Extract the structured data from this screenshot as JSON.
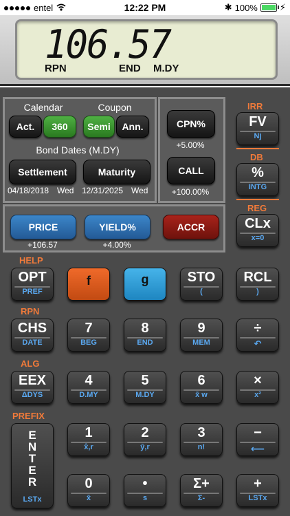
{
  "status": {
    "carrier": "entel",
    "time": "12:22 PM",
    "battery": "100%",
    "battery_level": 1.0
  },
  "display": {
    "value": "106.57",
    "indicators": [
      "RPN",
      "END",
      "M.DY"
    ]
  },
  "calendar_panel": {
    "calendar_label": "Calendar",
    "coupon_label": "Coupon",
    "act": "Act.",
    "d360": "360",
    "semi": "Semi",
    "ann": "Ann.",
    "bond_dates_label": "Bond Dates (M.DY)",
    "settlement": "Settlement",
    "maturity": "Maturity",
    "settlement_date": "04/18/2018",
    "settlement_day": "Wed",
    "maturity_date": "12/31/2025",
    "maturity_day": "Wed"
  },
  "coupon_panel": {
    "cpn": "CPN%",
    "cpn_value": "+5.00%",
    "call": "CALL",
    "call_value": "+100.00%"
  },
  "price_panel": {
    "price": "PRICE",
    "price_value": "+106.57",
    "yield": "YIELD%",
    "yield_value": "+4.00%",
    "accr": "ACCR"
  },
  "right_keys": {
    "irr_label": "IRR",
    "fv": "FV",
    "fv_sub": "Nj",
    "db_label": "DB",
    "pct": "%",
    "pct_sub": "INTG",
    "reg_label": "REG",
    "clx": "CLx",
    "clx_sub": "x=0"
  },
  "row_labels": {
    "help": "HELP",
    "rpn": "RPN",
    "alg": "ALG",
    "prefix": "PREFIX"
  },
  "keys": {
    "r1": [
      {
        "m": "OPT",
        "b": "PREF"
      },
      {
        "m": "f",
        "b": ""
      },
      {
        "m": "g",
        "b": ""
      },
      {
        "m": "STO",
        "b": "("
      },
      {
        "m": "RCL",
        "b": ")"
      }
    ],
    "r2": [
      {
        "m": "CHS",
        "b": "DATE"
      },
      {
        "m": "7",
        "b": "BEG"
      },
      {
        "m": "8",
        "b": "END"
      },
      {
        "m": "9",
        "b": "MEM"
      },
      {
        "m": "÷",
        "b": "↶"
      }
    ],
    "r3": [
      {
        "m": "EEX",
        "b": "ΔDYS"
      },
      {
        "m": "4",
        "b": "D.MY"
      },
      {
        "m": "5",
        "b": "M.DY"
      },
      {
        "m": "6",
        "b": "x̄ w"
      },
      {
        "m": "×",
        "b": "x²"
      }
    ],
    "r4": [
      {
        "m": "1",
        "b": "x̂,r"
      },
      {
        "m": "2",
        "b": "ŷ,r"
      },
      {
        "m": "3",
        "b": "n!"
      },
      {
        "m": "−",
        "b": "⟵"
      }
    ],
    "r5": [
      {
        "m": "0",
        "b": "x̄"
      },
      {
        "m": "•",
        "b": "s"
      },
      {
        "m": "Σ+",
        "b": "Σ-"
      },
      {
        "m": "+",
        "b": "LSTx"
      }
    ],
    "enter": {
      "m": "ENTER",
      "b": "LSTx"
    }
  }
}
